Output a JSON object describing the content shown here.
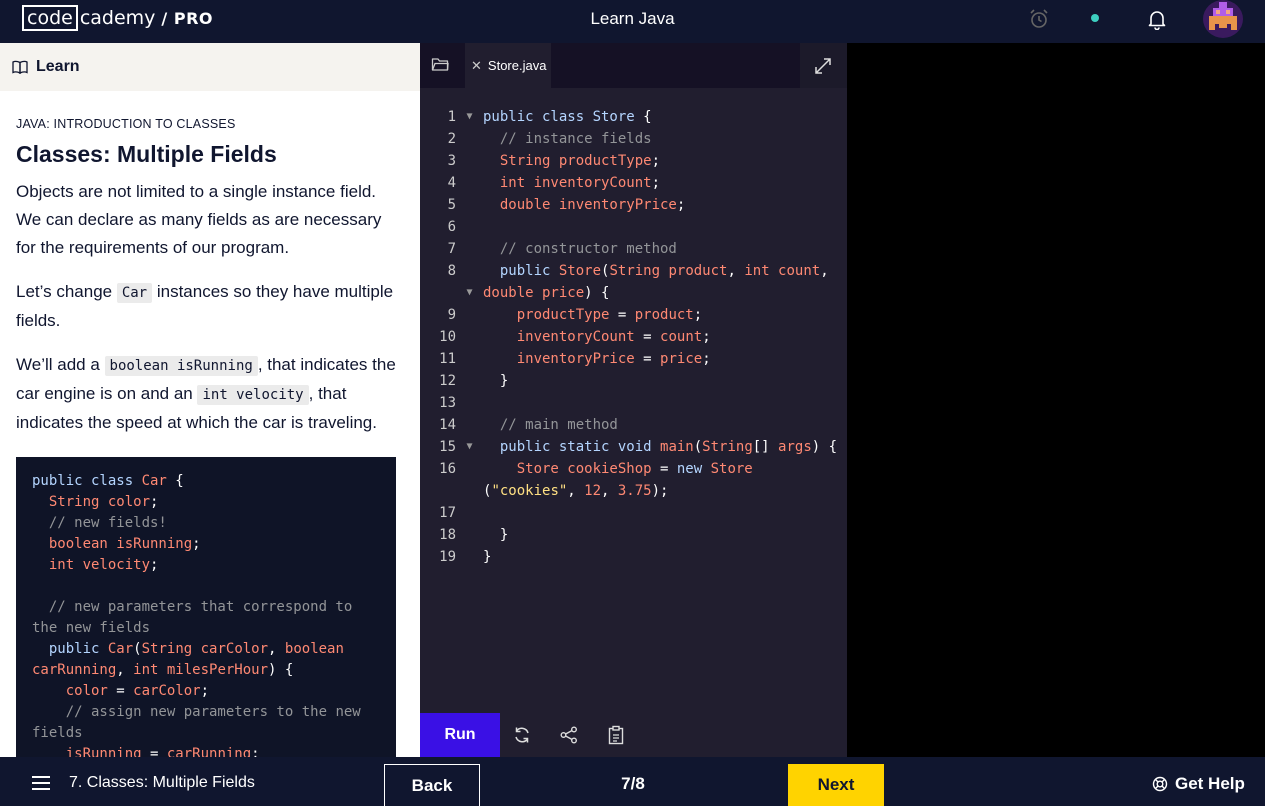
{
  "header": {
    "logo_box": "code",
    "logo_rest": "cademy",
    "logo_pro": "/ PRO",
    "title": "Learn Java"
  },
  "left_panel": {
    "learn_label": "Learn",
    "breadcrumb": "JAVA: INTRODUCTION TO CLASSES",
    "title": "Classes: Multiple Fields",
    "p1": "Objects are not limited to a single instance field. We can declare as many fields as are necessary for the requirements of our program.",
    "p2_before": "Let’s change ",
    "p2_code": "Car",
    "p2_after": " instances so they have multiple fields.",
    "p3_before": "We’ll add a ",
    "p3_code1": "boolean isRunning",
    "p3_mid": ", that indicates the car engine is on and an ",
    "p3_code2": "int velocity",
    "p3_after": ", that indicates the speed at which the car is traveling.",
    "snippet_tokens": [
      {
        "t": "public class ",
        "c": "kw"
      },
      {
        "t": "Car",
        "c": "ty"
      },
      {
        "t": " {\n",
        "c": ""
      },
      {
        "t": "  String color",
        "c": "ty"
      },
      {
        "t": ";\n",
        "c": ""
      },
      {
        "t": "  // new fields!\n",
        "c": "cm"
      },
      {
        "t": "  boolean isRunning",
        "c": "ty"
      },
      {
        "t": ";\n",
        "c": ""
      },
      {
        "t": "  int velocity",
        "c": "ty"
      },
      {
        "t": ";\n\n",
        "c": ""
      },
      {
        "t": "  // new parameters that correspond to the new fields\n",
        "c": "cm"
      },
      {
        "t": "  public ",
        "c": "kw"
      },
      {
        "t": "Car",
        "c": "ty"
      },
      {
        "t": "(",
        "c": ""
      },
      {
        "t": "String carColor",
        "c": "ty"
      },
      {
        "t": ", ",
        "c": ""
      },
      {
        "t": "boolean carRunning",
        "c": "ty"
      },
      {
        "t": ", ",
        "c": ""
      },
      {
        "t": "int milesPerHour",
        "c": "ty"
      },
      {
        "t": ") {\n",
        "c": ""
      },
      {
        "t": "    color",
        "c": "ty"
      },
      {
        "t": " = ",
        "c": ""
      },
      {
        "t": "carColor",
        "c": "ty"
      },
      {
        "t": ";\n",
        "c": ""
      },
      {
        "t": "    // assign new parameters to the new fields\n",
        "c": "cm"
      },
      {
        "t": "    isRunning",
        "c": "ty"
      },
      {
        "t": " = ",
        "c": ""
      },
      {
        "t": "carRunning",
        "c": "ty"
      },
      {
        "t": ";\n",
        "c": ""
      }
    ]
  },
  "editor": {
    "tab_name": "Store.java",
    "run_label": "Run",
    "lines": [
      {
        "n": "1",
        "fold": true,
        "tokens": [
          {
            "t": "public class ",
            "c": "kw"
          },
          {
            "t": "Store",
            "c": "kw"
          },
          {
            "t": " {",
            "c": ""
          }
        ]
      },
      {
        "n": "2",
        "tokens": [
          {
            "t": "  // instance fields",
            "c": "cm"
          }
        ]
      },
      {
        "n": "3",
        "tokens": [
          {
            "t": "  String productType",
            "c": "ty"
          },
          {
            "t": ";",
            "c": ""
          }
        ]
      },
      {
        "n": "4",
        "tokens": [
          {
            "t": "  int inventoryCount",
            "c": "ty"
          },
          {
            "t": ";",
            "c": ""
          }
        ]
      },
      {
        "n": "5",
        "tokens": [
          {
            "t": "  double inventoryPrice",
            "c": "ty"
          },
          {
            "t": ";",
            "c": ""
          }
        ]
      },
      {
        "n": "6",
        "tokens": []
      },
      {
        "n": "7",
        "tokens": [
          {
            "t": "  // constructor method",
            "c": "cm"
          }
        ]
      },
      {
        "n": "8",
        "tokens": [
          {
            "t": "  public ",
            "c": "kw"
          },
          {
            "t": "Store",
            "c": "ty"
          },
          {
            "t": "(",
            "c": ""
          },
          {
            "t": "String product",
            "c": "ty"
          },
          {
            "t": ", ",
            "c": ""
          },
          {
            "t": "int count",
            "c": "ty"
          },
          {
            "t": ",",
            "c": ""
          }
        ]
      },
      {
        "n": "",
        "fold": true,
        "tokens": [
          {
            "t": "double price",
            "c": "ty"
          },
          {
            "t": ") {",
            "c": ""
          }
        ]
      },
      {
        "n": "9",
        "tokens": [
          {
            "t": "    productType",
            "c": "ty"
          },
          {
            "t": " = ",
            "c": ""
          },
          {
            "t": "product",
            "c": "ty"
          },
          {
            "t": ";",
            "c": ""
          }
        ]
      },
      {
        "n": "10",
        "tokens": [
          {
            "t": "    inventoryCount",
            "c": "ty"
          },
          {
            "t": " = ",
            "c": ""
          },
          {
            "t": "count",
            "c": "ty"
          },
          {
            "t": ";",
            "c": ""
          }
        ]
      },
      {
        "n": "11",
        "tokens": [
          {
            "t": "    inventoryPrice",
            "c": "ty"
          },
          {
            "t": " = ",
            "c": ""
          },
          {
            "t": "price",
            "c": "ty"
          },
          {
            "t": ";",
            "c": ""
          }
        ]
      },
      {
        "n": "12",
        "tokens": [
          {
            "t": "  }",
            "c": ""
          }
        ]
      },
      {
        "n": "13",
        "tokens": []
      },
      {
        "n": "14",
        "tokens": [
          {
            "t": "  // main method",
            "c": "cm"
          }
        ]
      },
      {
        "n": "15",
        "fold": true,
        "tokens": [
          {
            "t": "  public static void ",
            "c": "kw"
          },
          {
            "t": "main",
            "c": "ty"
          },
          {
            "t": "(",
            "c": ""
          },
          {
            "t": "String",
            "c": "ty"
          },
          {
            "t": "[] ",
            "c": ""
          },
          {
            "t": "args",
            "c": "ty"
          },
          {
            "t": ") {",
            "c": ""
          }
        ]
      },
      {
        "n": "16",
        "tokens": [
          {
            "t": "    Store cookieShop",
            "c": "ty"
          },
          {
            "t": " = ",
            "c": ""
          },
          {
            "t": "new ",
            "c": "kw"
          },
          {
            "t": "Store",
            "c": "ty"
          }
        ]
      },
      {
        "n": "",
        "tokens": [
          {
            "t": "(",
            "c": ""
          },
          {
            "t": "\"cookies\"",
            "c": "st"
          },
          {
            "t": ", ",
            "c": ""
          },
          {
            "t": "12",
            "c": "nu"
          },
          {
            "t": ", ",
            "c": ""
          },
          {
            "t": "3.75",
            "c": "nu"
          },
          {
            "t": ");",
            "c": ""
          }
        ]
      },
      {
        "n": "17",
        "tokens": []
      },
      {
        "n": "18",
        "tokens": [
          {
            "t": "  }",
            "c": ""
          }
        ]
      },
      {
        "n": "19",
        "tokens": [
          {
            "t": "}",
            "c": ""
          }
        ]
      }
    ]
  },
  "footer": {
    "lesson_label": "7. Classes: Multiple Fields",
    "back_label": "Back",
    "progress": "7/8",
    "next_label": "Next",
    "help_label": "Get Help"
  },
  "colors": {
    "navy": "#10162f",
    "run_button": "#3a10e5",
    "next_button": "#ffd300",
    "status_dot": "#3dcfc1"
  }
}
